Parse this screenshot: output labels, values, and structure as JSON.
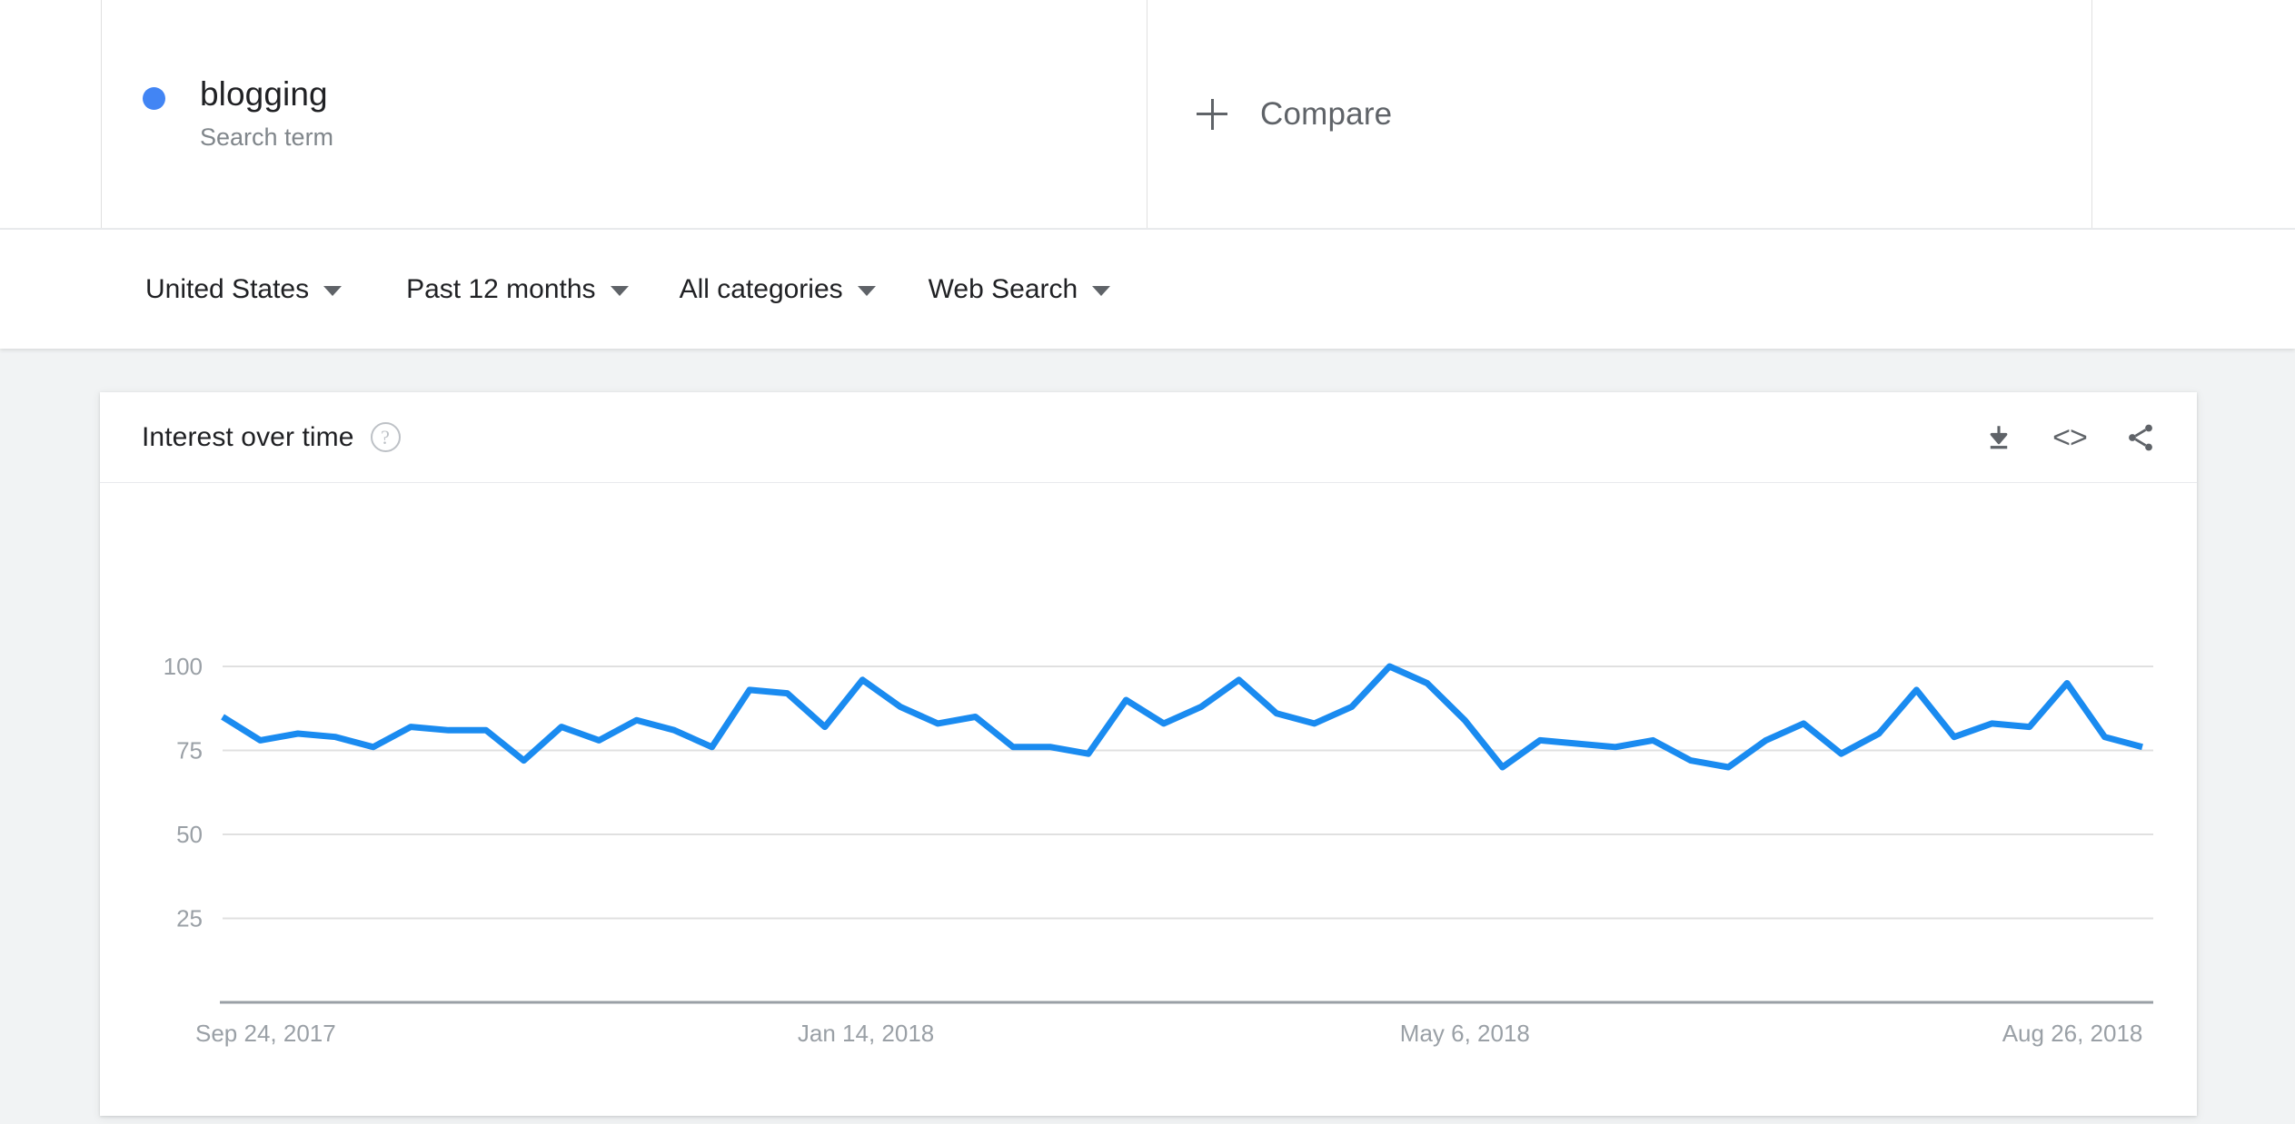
{
  "terms": {
    "items": [
      {
        "label": "blogging",
        "type_label": "Search term",
        "color": "#4285f4"
      }
    ],
    "compare_label": "Compare"
  },
  "filters": [
    {
      "label": "United States"
    },
    {
      "label": "Past 12 months"
    },
    {
      "label": "All categories"
    },
    {
      "label": "Web Search"
    }
  ],
  "card": {
    "title": "Interest over time",
    "help_icon": "help-circle-icon",
    "actions": [
      {
        "name": "download-csv-button",
        "icon": "download-icon"
      },
      {
        "name": "embed-button",
        "icon": "code-embed-icon",
        "glyph": "<>"
      },
      {
        "name": "share-button",
        "icon": "share-icon"
      }
    ]
  },
  "chart_data": {
    "type": "line",
    "title": "Interest over time",
    "xlabel": "",
    "ylabel": "",
    "ylim": [
      0,
      105
    ],
    "grid": true,
    "legend": "none",
    "line_color": "#1a8bf0",
    "gridline_color": "#e0e0e0",
    "ytick_labels": [
      "100",
      "75",
      "50",
      "25"
    ],
    "ytick_values": [
      100,
      75,
      50,
      25
    ],
    "xtick_labels": [
      "Sep 24, 2017",
      "Jan 14, 2018",
      "May 6, 2018",
      "Aug 26, 2018"
    ],
    "xtick_indices": [
      0,
      16,
      32,
      48
    ],
    "series": [
      {
        "name": "blogging",
        "color": "#1a8bf0",
        "values": [
          85,
          78,
          80,
          79,
          76,
          82,
          81,
          81,
          72,
          82,
          78,
          84,
          81,
          76,
          93,
          92,
          82,
          96,
          88,
          83,
          85,
          76,
          76,
          74,
          90,
          83,
          88,
          96,
          86,
          83,
          88,
          100,
          95,
          84,
          70,
          78,
          77,
          76,
          78,
          72,
          70,
          78,
          83,
          74,
          80,
          93,
          79,
          83,
          82,
          95,
          79,
          76
        ]
      }
    ]
  }
}
